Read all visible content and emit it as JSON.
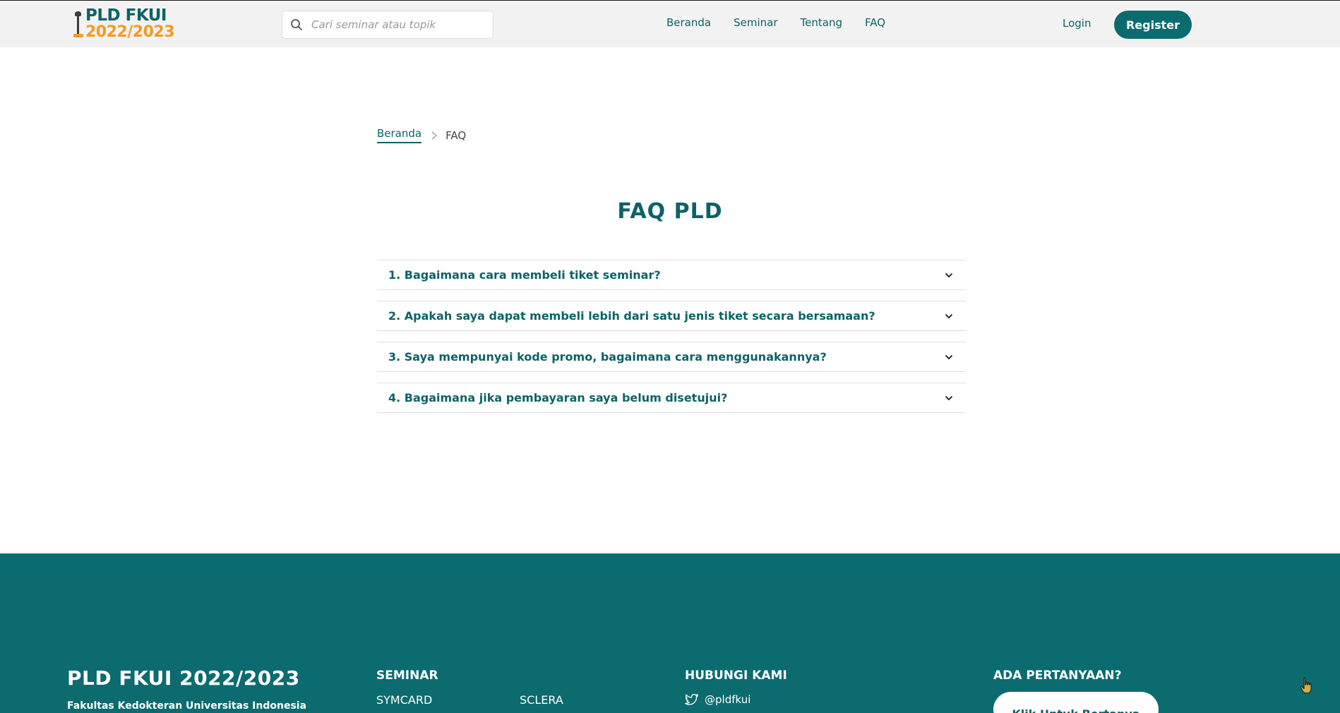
{
  "header": {
    "logo_line1": "PLD FKUI",
    "logo_line2": "2022/2023",
    "search_placeholder": "Cari seminar atau topik",
    "nav": [
      "Beranda",
      "Seminar",
      "Tentang",
      "FAQ"
    ],
    "login_label": "Login",
    "register_label": "Register"
  },
  "breadcrumb": {
    "home": "Beranda",
    "current": "FAQ"
  },
  "page_title": "FAQ PLD",
  "faq": [
    "1. Bagaimana cara membeli tiket seminar?",
    "2. Apakah saya dapat membeli lebih dari satu jenis tiket secara bersamaan?",
    "3. Saya mempunyai kode promo, bagaimana cara menggunakannya?",
    "4. Bagaimana jika pembayaran saya belum disetujui?"
  ],
  "footer": {
    "brand": "PLD FKUI 2022/2023",
    "subtitle": "Fakultas Kedokteran Universitas Indonesia",
    "seminar_heading": "SEMINAR",
    "seminar_links": [
      "SYMCARD",
      "SCLERA"
    ],
    "contact_heading": "HUBUNGI KAMI",
    "twitter_handle": "@pldfkui",
    "question_heading": "ADA PERTANYAAN?",
    "ask_button": "Klik Untuk Bertanya"
  },
  "colors": {
    "primary": "#0c6b6e",
    "accent": "#f59a23",
    "header_bg": "#f2f2f2"
  },
  "icons": {
    "search": "search-icon",
    "breadcrumb_separator": "chevron-right-icon",
    "faq_toggle": "chevron-down-icon",
    "twitter": "twitter-icon",
    "logo": "logo-icon"
  }
}
